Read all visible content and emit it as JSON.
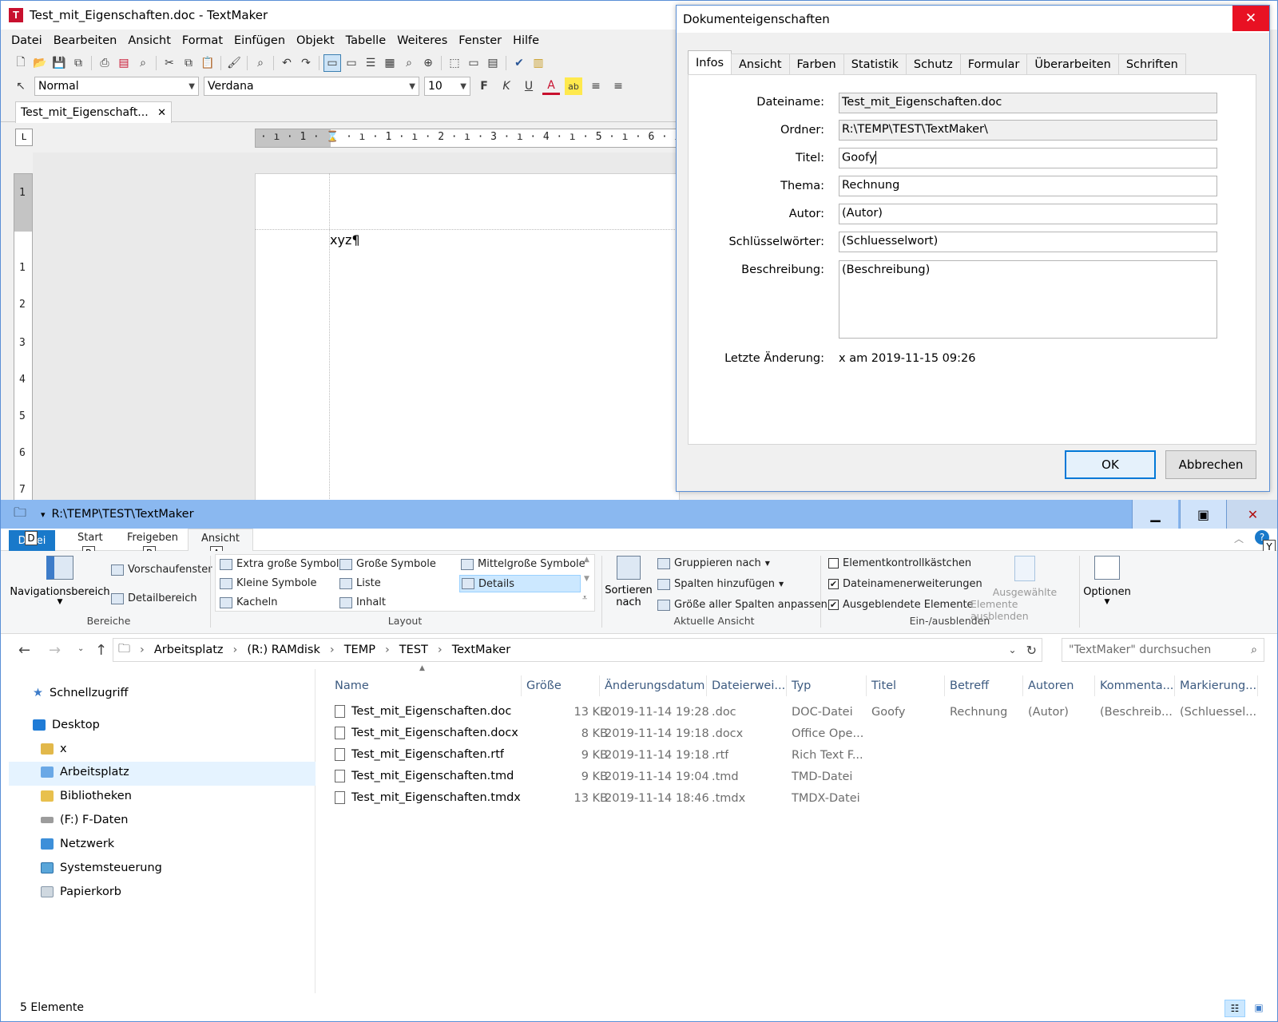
{
  "textmaker": {
    "title": "Test_mit_Eigenschaften.doc - TextMaker",
    "logo_letter": "T",
    "menu": [
      "Datei",
      "Bearbeiten",
      "Ansicht",
      "Format",
      "Einfügen",
      "Objekt",
      "Tabelle",
      "Weiteres",
      "Fenster",
      "Hilfe"
    ],
    "style": "Normal",
    "font": "Verdana",
    "size": "10",
    "bold": "F",
    "italic": "K",
    "underline": "U",
    "doc_tab": "Test_mit_Eigenschaft...",
    "ruler_corner": "L",
    "hruler": "· ı · 1 · ⌛ · ı · 1 · ı · 2 · ı · 3 · ı · 4 · ı · 5 · ı · 6 · ı · 7 · ı · 8 · ı · 9",
    "vruler": [
      "1",
      "1",
      "2",
      "3",
      "4",
      "5",
      "6",
      "7"
    ],
    "doc_text": "xyz¶"
  },
  "dialog": {
    "title": "Dokumenteigenschaften",
    "tabs": [
      "Infos",
      "Ansicht",
      "Farben",
      "Statistik",
      "Schutz",
      "Formular",
      "Überarbeiten",
      "Schriften"
    ],
    "fields": {
      "dateiname": {
        "label": "Dateiname:",
        "value": "Test_mit_Eigenschaften.doc"
      },
      "ordner": {
        "label": "Ordner:",
        "value": "R:\\TEMP\\TEST\\TextMaker\\"
      },
      "titel": {
        "label": "Titel:",
        "value": "Goofy"
      },
      "thema": {
        "label": "Thema:",
        "value": "Rechnung"
      },
      "autor": {
        "label": "Autor:",
        "value": "(Autor)"
      },
      "schluessel": {
        "label": "Schlüsselwörter:",
        "value": "(Schluesselwort)"
      },
      "beschreibung": {
        "label": "Beschreibung:",
        "value": "(Beschreibung)"
      }
    },
    "last_change_label": "Letzte Änderung:",
    "last_change_value": "x am 2019-11-15 09:26",
    "ok": "OK",
    "cancel": "Abbrechen"
  },
  "explorer": {
    "title": "R:\\TEMP\\TEST\\TextMaker",
    "ribbon_tabs": {
      "file": "Datei",
      "start": "Start",
      "share": "Freigeben",
      "view": "Ansicht"
    },
    "keytips": {
      "file": "D",
      "start": "R",
      "share": "B",
      "view": "A",
      "help": "Y"
    },
    "groups": {
      "bereiche": "Bereiche",
      "layout": "Layout",
      "aktuelle": "Aktuelle Ansicht",
      "einaus": "Ein-/ausblenden"
    },
    "panes": {
      "nav": "Navigationsbereich",
      "preview": "Vorschaufenster",
      "details": "Detailbereich"
    },
    "layout_items": {
      "xl": "Extra große Symbole",
      "large": "Große Symbole",
      "medium": "Mittelgroße Symbole",
      "small": "Kleine Symbole",
      "list": "Liste",
      "details": "Details",
      "tiles": "Kacheln",
      "content": "Inhalt"
    },
    "current_view": {
      "sort1": "Sortieren",
      "sort2": "nach",
      "group": "Gruppieren nach",
      "addcols": "Spalten hinzufügen",
      "fitcols": "Größe aller Spalten anpassen"
    },
    "showhide": {
      "checkboxes": "Elementkontrollkästchen",
      "extensions": "Dateinamenerweiterungen",
      "hidden": "Ausgeblendete Elemente",
      "hide1": "Ausgewählte",
      "hide2": "Elemente ausblenden",
      "options": "Optionen"
    },
    "breadcrumb": [
      "Arbeitsplatz",
      "(R:) RAMdisk",
      "TEMP",
      "TEST",
      "TextMaker"
    ],
    "search_placeholder": "\"TextMaker\" durchsuchen",
    "nav": {
      "quick": "Schnellzugriff",
      "desktop": "Desktop",
      "x": "x",
      "pc": "Arbeitsplatz",
      "libs": "Bibliotheken",
      "fdrive": "(F:) F-Daten",
      "network": "Netzwerk",
      "control": "Systemsteuerung",
      "recycle": "Papierkorb"
    },
    "columns": [
      "Name",
      "Größe",
      "Änderungsdatum",
      "Dateierwei...",
      "Typ",
      "Titel",
      "Betreff",
      "Autoren",
      "Kommenta...",
      "Markierung..."
    ],
    "files": [
      {
        "name": "Test_mit_Eigenschaften.doc",
        "size": "13 KB",
        "date": "2019-11-14 19:28",
        "ext": ".doc",
        "type": "DOC-Datei",
        "title": "Goofy",
        "subject": "Rechnung",
        "author": "(Autor)",
        "comment": "(Beschreib...",
        "tags": "(Schluessel..."
      },
      {
        "name": "Test_mit_Eigenschaften.docx",
        "size": "8 KB",
        "date": "2019-11-14 19:18",
        "ext": ".docx",
        "type": "Office Ope...",
        "title": "",
        "subject": "",
        "author": "",
        "comment": "",
        "tags": ""
      },
      {
        "name": "Test_mit_Eigenschaften.rtf",
        "size": "9 KB",
        "date": "2019-11-14 19:18",
        "ext": ".rtf",
        "type": "Rich Text F...",
        "title": "",
        "subject": "",
        "author": "",
        "comment": "",
        "tags": ""
      },
      {
        "name": "Test_mit_Eigenschaften.tmd",
        "size": "9 KB",
        "date": "2019-11-14 19:04",
        "ext": ".tmd",
        "type": "TMD-Datei",
        "title": "",
        "subject": "",
        "author": "",
        "comment": "",
        "tags": ""
      },
      {
        "name": "Test_mit_Eigenschaften.tmdx",
        "size": "13 KB",
        "date": "2019-11-14 18:46",
        "ext": ".tmdx",
        "type": "TMDX-Datei",
        "title": "",
        "subject": "",
        "author": "",
        "comment": "",
        "tags": ""
      }
    ],
    "status": "5 Elemente"
  }
}
